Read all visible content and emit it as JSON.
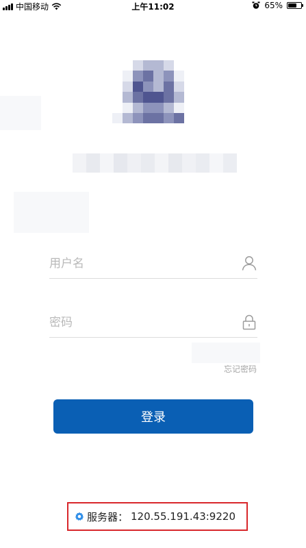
{
  "status_bar": {
    "carrier": "中国移动",
    "time": "上午11:02",
    "battery_percent_label": "65%",
    "battery_level": 0.65,
    "icons": [
      "signal-icon",
      "wifi-icon",
      "alarm-icon",
      "battery-icon"
    ]
  },
  "login": {
    "username_placeholder": "用户名",
    "password_placeholder": "密码",
    "forgot_password": "忘记密码",
    "login_button": "登录"
  },
  "server": {
    "label": "服务器：",
    "address": "120.55.191.43:9220",
    "icon": "gear-icon"
  },
  "colors": {
    "primary": "#0a5fb4",
    "highlight_border": "#d8262a",
    "placeholder": "#b9b9b9",
    "divider": "#dcdcdc"
  }
}
